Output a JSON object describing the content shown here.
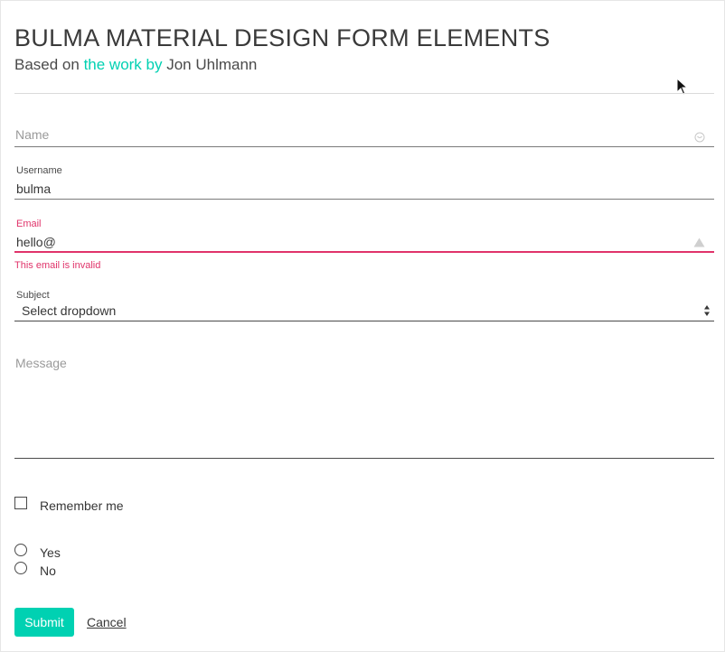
{
  "header": {
    "title": "BULMA MATERIAL DESIGN FORM ELEMENTS",
    "subtitle_prefix": "Based on ",
    "subtitle_link": "the work by",
    "subtitle_suffix": " Jon Uhlmann"
  },
  "form": {
    "name": {
      "placeholder": "Name",
      "icon": "smiley-icon"
    },
    "username": {
      "label": "Username",
      "value": "bulma"
    },
    "email": {
      "label": "Email",
      "value": "hello@",
      "error": "This email is invalid",
      "icon": "warning-icon"
    },
    "subject": {
      "label": "Subject",
      "selected": "Select dropdown"
    },
    "message": {
      "placeholder": "Message"
    },
    "remember": {
      "label": "Remember me",
      "checked": false
    },
    "radios": [
      {
        "label": "Yes",
        "checked": false
      },
      {
        "label": "No",
        "checked": false
      }
    ],
    "submit_label": "Submit",
    "cancel_label": "Cancel"
  },
  "colors": {
    "primary": "#00d1b2",
    "danger": "#e0336a",
    "text": "#363636",
    "placeholder": "#9a9a9a"
  }
}
